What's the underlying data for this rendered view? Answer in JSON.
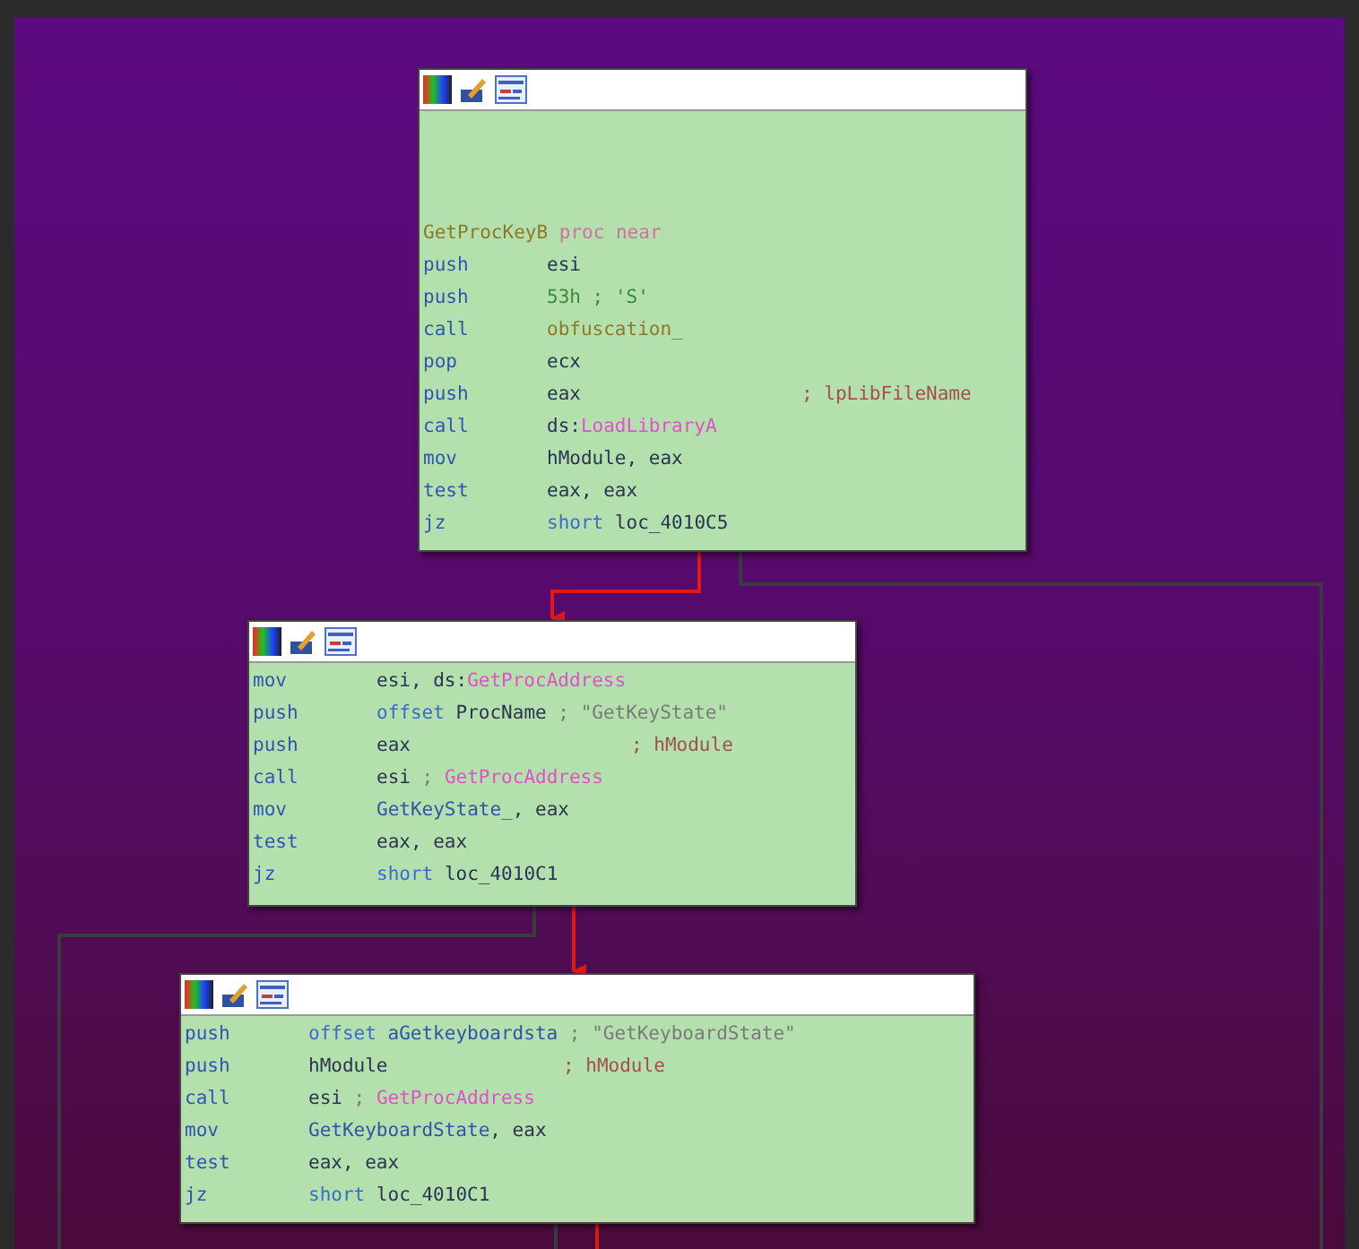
{
  "nodes": [
    {
      "lines": [
        {
          "kind": "label",
          "parts": [
            {
              "text": "GetProcKeyB",
              "kind": "label"
            },
            {
              "text": "proc near",
              "kind": "directive"
            }
          ]
        },
        {
          "kind": "instruction",
          "mnemonic": "push",
          "parts": [
            {
              "text": "esi",
              "kind": "register"
            }
          ]
        },
        {
          "kind": "instruction",
          "mnemonic": "push",
          "parts": [
            {
              "text": "53h",
              "kind": "number"
            },
            {
              "text": "; 'S'",
              "kind": "number"
            }
          ]
        },
        {
          "kind": "instruction",
          "mnemonic": "call",
          "parts": [
            {
              "text": "obfuscation_",
              "kind": "label"
            }
          ]
        },
        {
          "kind": "instruction",
          "mnemonic": "pop",
          "parts": [
            {
              "text": "ecx",
              "kind": "register"
            }
          ]
        },
        {
          "kind": "instruction",
          "mnemonic": "push",
          "parts": [
            {
              "text": "eax",
              "kind": "register"
            }
          ],
          "comment": [
            {
              "text": "; lpLibFileName",
              "kind": "argname"
            }
          ]
        },
        {
          "kind": "instruction",
          "mnemonic": "call",
          "parts": [
            {
              "text": "ds:",
              "kind": "register"
            },
            {
              "text": "LoadLibraryA",
              "kind": "import",
              "join": true
            }
          ]
        },
        {
          "kind": "instruction",
          "mnemonic": "mov",
          "parts": [
            {
              "text": "hModule, eax",
              "kind": "register"
            }
          ]
        },
        {
          "kind": "instruction",
          "mnemonic": "test",
          "parts": [
            {
              "text": "eax, eax",
              "kind": "register"
            }
          ]
        },
        {
          "kind": "instruction",
          "mnemonic": "jz",
          "parts": [
            {
              "text": "short",
              "kind": "keyword"
            },
            {
              "text": "loc_4010C5",
              "kind": "register"
            }
          ]
        }
      ]
    },
    {
      "lines": [
        {
          "kind": "instruction",
          "mnemonic": "mov",
          "parts": [
            {
              "text": "esi, ds:",
              "kind": "register"
            },
            {
              "text": "GetProcAddress",
              "kind": "import",
              "join": true
            }
          ]
        },
        {
          "kind": "instruction",
          "mnemonic": "push",
          "parts": [
            {
              "text": "offset",
              "kind": "keyword"
            },
            {
              "text": "ProcName",
              "kind": "register"
            },
            {
              "text": "; \"GetKeyState\"",
              "kind": "string"
            }
          ]
        },
        {
          "kind": "instruction",
          "mnemonic": "push",
          "parts": [
            {
              "text": "eax",
              "kind": "register"
            }
          ],
          "comment": [
            {
              "text": "; hModule",
              "kind": "argname"
            }
          ]
        },
        {
          "kind": "instruction",
          "mnemonic": "call",
          "parts": [
            {
              "text": "esi",
              "kind": "register"
            },
            {
              "text": ";",
              "kind": "string"
            },
            {
              "text": "GetProcAddress",
              "kind": "import"
            }
          ]
        },
        {
          "kind": "instruction",
          "mnemonic": "mov",
          "parts": [
            {
              "text": "GetKeyState_",
              "kind": "name"
            },
            {
              "text": ", eax",
              "kind": "register",
              "join": true
            }
          ]
        },
        {
          "kind": "instruction",
          "mnemonic": "test",
          "parts": [
            {
              "text": "eax, eax",
              "kind": "register"
            }
          ]
        },
        {
          "kind": "instruction",
          "mnemonic": "jz",
          "parts": [
            {
              "text": "short",
              "kind": "keyword"
            },
            {
              "text": "loc_4010C1",
              "kind": "register"
            }
          ]
        }
      ]
    },
    {
      "lines": [
        {
          "kind": "instruction",
          "mnemonic": "push",
          "parts": [
            {
              "text": "offset",
              "kind": "keyword"
            },
            {
              "text": "aGetkeyboardsta",
              "kind": "name"
            },
            {
              "text": "; \"GetKeyboardState\"",
              "kind": "string"
            }
          ]
        },
        {
          "kind": "instruction",
          "mnemonic": "push",
          "parts": [
            {
              "text": "hModule",
              "kind": "register"
            }
          ],
          "comment": [
            {
              "text": "; hModule",
              "kind": "argname"
            }
          ]
        },
        {
          "kind": "instruction",
          "mnemonic": "call",
          "parts": [
            {
              "text": "esi",
              "kind": "register"
            },
            {
              "text": ";",
              "kind": "string"
            },
            {
              "text": "GetProcAddress",
              "kind": "import"
            }
          ]
        },
        {
          "kind": "instruction",
          "mnemonic": "mov",
          "parts": [
            {
              "text": "GetKeyboardState",
              "kind": "name"
            },
            {
              "text": ", eax",
              "kind": "register",
              "join": true
            }
          ]
        },
        {
          "kind": "instruction",
          "mnemonic": "test",
          "parts": [
            {
              "text": "eax, eax",
              "kind": "register"
            }
          ]
        },
        {
          "kind": "instruction",
          "mnemonic": "jz",
          "parts": [
            {
              "text": "short",
              "kind": "keyword"
            },
            {
              "text": "loc_4010C1",
              "kind": "register"
            }
          ]
        }
      ]
    }
  ]
}
